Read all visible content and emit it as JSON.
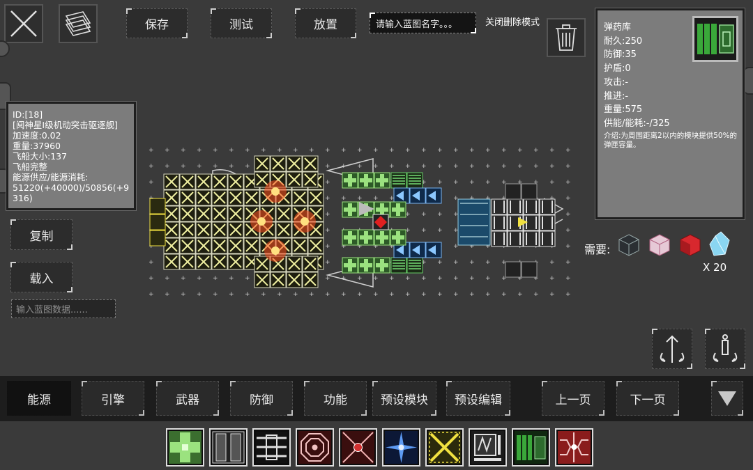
{
  "toolbar": {
    "save": "保存",
    "test": "测试",
    "place": "放置",
    "name_placeholder": "请输入蓝图名字。。。",
    "delete_mode": "关闭删除模式"
  },
  "ship_info": {
    "id": "ID:[18]",
    "name": "[阋神星I级机动突击驱逐舰]",
    "accel": "加速度:0.02",
    "weight": "重量:37960",
    "size": "飞船大小:137",
    "status": "飞船完整",
    "energy_label": "能源供应/能源消耗:",
    "energy_value": "51220(+40000)/50856(+9316)"
  },
  "module": {
    "name": "弹药库",
    "durability": "耐久:250",
    "defense": "防御:35",
    "shield": "护盾:0",
    "attack": "攻击:-",
    "thrust": "推进:-",
    "weight": "重量:575",
    "power": "供能/能耗:-/325",
    "desc": "介绍:为周围距离2以内的模块提供50%的弹匣容量。"
  },
  "left_actions": {
    "copy": "复制",
    "load": "载入",
    "data_placeholder": "输入蓝图数据......"
  },
  "needs": {
    "label": "需要:",
    "count": "X 20"
  },
  "tabs": [
    {
      "label": "能源"
    },
    {
      "label": "引擎"
    },
    {
      "label": "武器"
    },
    {
      "label": "防御"
    },
    {
      "label": "功能"
    },
    {
      "label": "预设模块"
    },
    {
      "label": "预设编辑"
    },
    {
      "label": "上一页"
    },
    {
      "label": "下一页"
    }
  ],
  "colors": {
    "panel": "#7c7c7c",
    "tabbar": "#1d1d1d",
    "background": "#3a3a3a"
  }
}
